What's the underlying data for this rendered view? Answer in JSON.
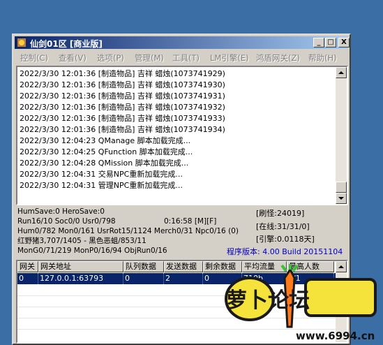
{
  "window": {
    "title": "仙剑01区 [商业版]",
    "controls": {
      "minimize": "_",
      "maximize": "□",
      "close": "X"
    }
  },
  "menu": [
    "控制(C)",
    "查看(V)",
    "选项(P)",
    "管理(M)",
    "工具(T)",
    "LM引擎(E)",
    "鸿盾网关(Z)",
    "帮助(H)"
  ],
  "log": [
    "2022/3/30 12:01:36 [制造物品] 吉祥 蜡烛(1073741929)",
    "2022/3/30 12:01:36 [制造物品] 吉祥 蜡烛(1073741930)",
    "2022/3/30 12:01:36 [制造物品] 吉祥 蜡烛(1073741931)",
    "2022/3/30 12:01:36 [制造物品] 吉祥 蜡烛(1073741932)",
    "2022/3/30 12:01:36 [制造物品] 吉祥 蜡烛(1073741933)",
    "2022/3/30 12:01:36 [制造物品] 吉祥 蜡烛(1073741934)",
    "2022/3/30 12:04:23 QManage 脚本加载完成...",
    "2022/3/30 12:04:25 QFunction 脚本加载完成...",
    "2022/3/30 12:04:28 QMission 脚本加载完成...",
    "2022/3/30 12:04:31 交易NPC重新加载完成...",
    "2022/3/30 12:04:31 管理NPC重新加载完成..."
  ],
  "status": {
    "line1": "HumSave:0 HeroSave:0",
    "line2": "Run16/10 Soc0/0 Usr0/798",
    "timer": "0:16:58 [M][F]",
    "line3": "Hum0/782 Mon0/161 UsrRot15/1124 Merch0/31 Npc0/16 (0)",
    "line4": "红野猪3,707/1405 - 黑色恶蛆/853/11",
    "line5": "MonG0/71/219 MonP0/16/94 ObjRun0/16",
    "refresh": "[刷怪:24019]",
    "online": "[在线:31/31/0]",
    "engine": "[引擎:0.0118天]",
    "version": "程序版本: 4.00 Build 20151104"
  },
  "table": {
    "headers": [
      "网关",
      "网关地址",
      "队列数据",
      "发送数据",
      "剩余数据",
      "平均流量",
      "最高人数"
    ],
    "rows": [
      [
        "0",
        "127.0.0.1:63793",
        "0",
        "2",
        "0",
        "710b",
        "1/1"
      ]
    ]
  },
  "watermark": {
    "text": "萝卜论坛",
    "url": "www.6994.cn"
  },
  "colors": {
    "titlebar_start": "#0a246a",
    "titlebar_end": "#a6caf0",
    "version_text": "#0000c0",
    "selected_row": "#0a246a",
    "desktop": "#3a6ea5"
  }
}
